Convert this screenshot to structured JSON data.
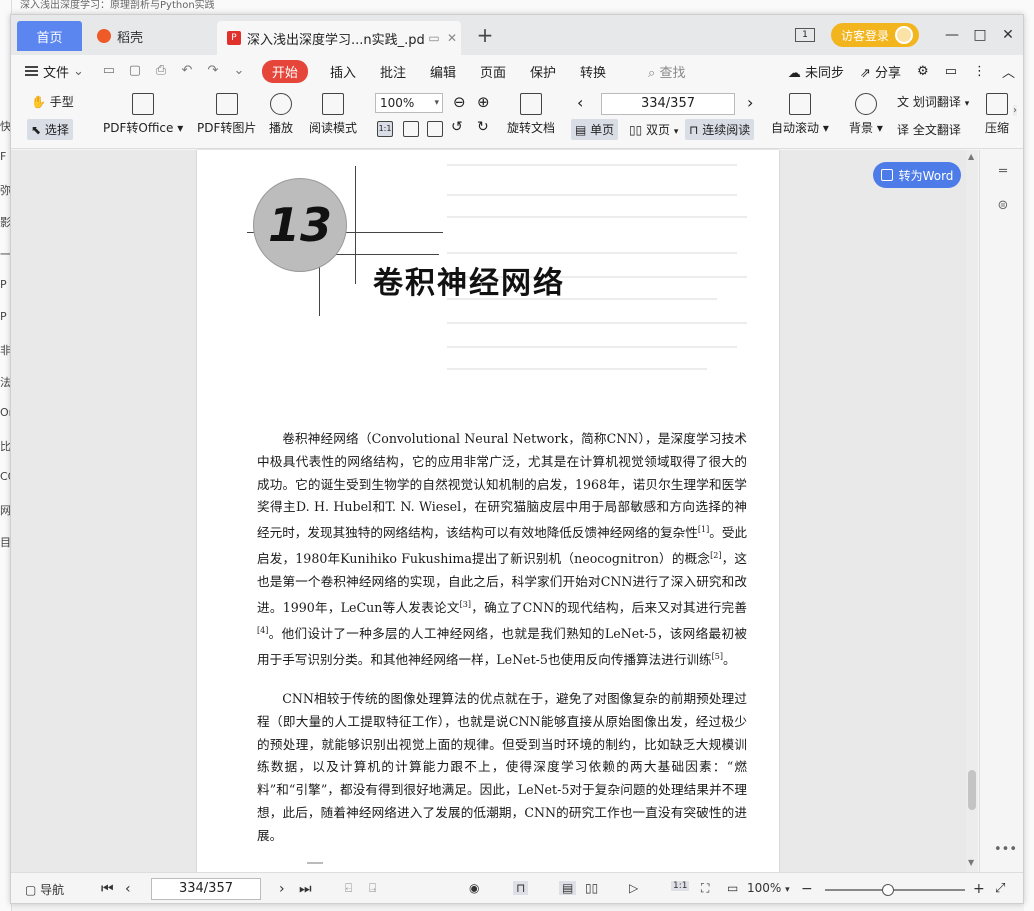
{
  "background": {
    "top_title": "深入浅出深度学习：原理剖析与Python实践",
    "left_fragments": [
      "快",
      "F",
      "弥",
      "影",
      "一",
      "P",
      "P",
      "非",
      "法",
      "Or",
      "比",
      "CO",
      "网",
      "目"
    ]
  },
  "tabs": {
    "home": "首页",
    "daoke": "稻壳",
    "doc": "深入浅出深度学习...n实践_.pdf",
    "add": "+"
  },
  "titlebar": {
    "guest_login": "访客登录",
    "page_indicator": "1",
    "minimize": "—",
    "maximize": "□",
    "close": "✕"
  },
  "menu": {
    "file": "文件",
    "start": "开始",
    "items": [
      "插入",
      "批注",
      "编辑",
      "页面",
      "保护",
      "转换"
    ],
    "search": "查找",
    "sync": "未同步",
    "share": "分享"
  },
  "ribbon": {
    "hand": "手型",
    "select": "选择",
    "pdf_to_office": "PDF转Office",
    "pdf_to_image": "PDF转图片",
    "play": "播放",
    "read_mode": "阅读模式",
    "zoom": "100%",
    "rotate_doc": "旋转文档",
    "page": "334/357",
    "single": "单页",
    "double": "双页",
    "continuous": "连续阅读",
    "auto_scroll": "自动滚动",
    "background": "背景",
    "word_translate": "划词翻译",
    "full_translate": "全文翻译",
    "compress": "压缩"
  },
  "to_word": "转为Word",
  "document": {
    "chapter_number": "13",
    "chapter_title": "卷积神经网络",
    "paragraph1_html": "卷积神经网络（Convolutional Neural Network，简称CNN），是深度学习技术中极具代表性的网络结构，它的应用非常广泛，尤其是在计算机视觉领域取得了很大的成功。它的诞生受到生物学的自然视觉认知机制的启发，1968年，诺贝尔生理学和医学奖得主D. H. Hubel和T. N. Wiesel，在研究猫脑皮层中用于局部敏感和方向选择的神经元时，发现其独特的网络结构，该结构可以有效地降低反馈神经网络的复杂性[1]。受此启发，1980年Kunihiko Fukushima提出了新识别机（neocognitron）的概念[2]，这也是第一个卷积神经网络的实现，自此之后，科学家们开始对CNN进行了深入研究和改进。1990年，LeCun等人发表论文[3]，确立了CNN的现代结构，后来又对其进行完善[4]。他们设计了一种多层的人工神经网络，也就是我们熟知的LeNet-5，该网络最初被用于手写识别分类。和其他神经网络一样，LeNet-5也使用反向传播算法进行训练[5]。",
    "paragraph2": "CNN相较于传统的图像处理算法的优点就在于，避免了对图像复杂的前期预处理过程（即大量的人工提取特征工作），也就是说CNN能够直接从原始图像出发，经过极少的预处理，就能够识别出视觉上面的规律。但受到当时环境的制约，比如缺乏大规模训练数据，以及计算机的计算能力跟不上，使得深度学习依赖的两大基础因素：“燃料”和“引擎”，都没有得到很好地满足。因此，LeNet-5对于复杂问题的处理结果并不理想，此后，随着神经网络进入了发展的低潮期，CNN的研究工作也一直没有突破性的进展。"
  },
  "statusbar": {
    "nav": "导航",
    "page": "334/357",
    "zoom": "100%",
    "zoom_level": 0.45
  }
}
